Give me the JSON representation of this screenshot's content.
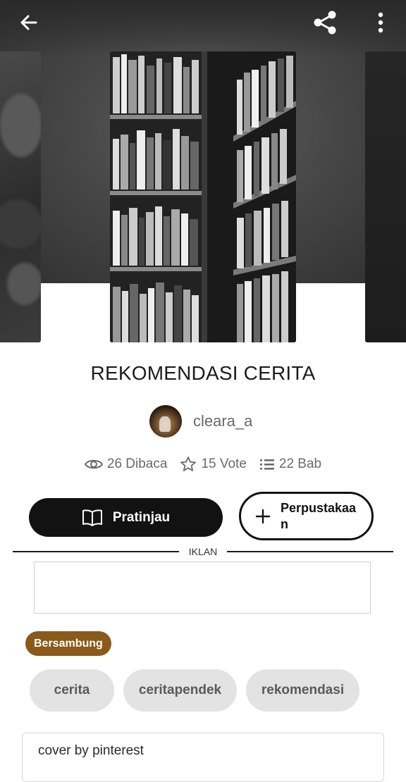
{
  "header": {
    "back_icon": "arrow-left-icon",
    "share_icon": "share-icon",
    "more_icon": "more-vertical-icon"
  },
  "story": {
    "title": "REKOMENDASI CERITA",
    "author": "cleara_a",
    "stats": {
      "reads": "26 Dibaca",
      "votes": "15 Vote",
      "chapters": "22 Bab"
    }
  },
  "actions": {
    "preview_label": "Pratinjau",
    "library_label": "Perpustakaan"
  },
  "ad": {
    "label": "IKLAN"
  },
  "status_badge": "Bersambung",
  "tags": [
    "cerita",
    "ceritapendek",
    "rekomendasi"
  ],
  "description": "cover by pinterest",
  "colors": {
    "badge": "#8a5a1a",
    "primary_button": "#121212",
    "tag_bg": "#e3e3e3"
  }
}
